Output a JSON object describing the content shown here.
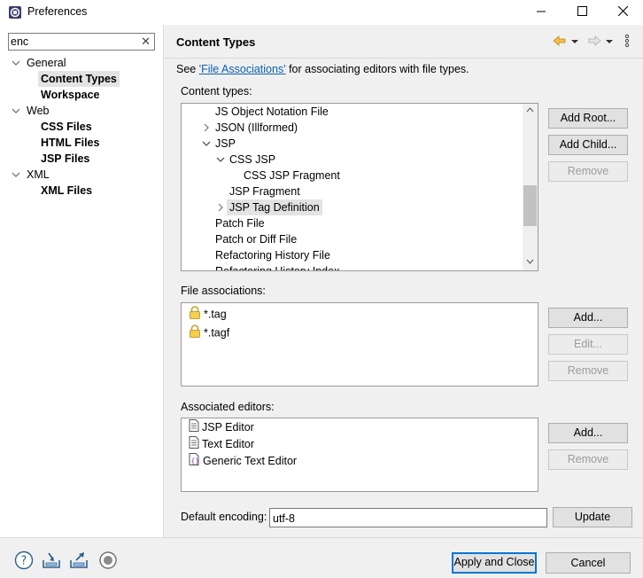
{
  "window": {
    "title": "Preferences",
    "minimize_icon": "minimize-icon",
    "maximize_icon": "maximize-icon",
    "close_icon": "close-icon"
  },
  "filter": {
    "value": "enc"
  },
  "nav_tree": [
    {
      "label": "General"
    },
    {
      "label": "Content Types"
    },
    {
      "label": "Workspace"
    },
    {
      "label": "Web"
    },
    {
      "label": "CSS Files"
    },
    {
      "label": "HTML Files"
    },
    {
      "label": "JSP Files"
    },
    {
      "label": "XML"
    },
    {
      "label": "XML Files"
    }
  ],
  "page": {
    "title": "Content Types",
    "see_prefix": "See ",
    "see_link": "'File Associations'",
    "see_suffix": " for associating editors with file types.",
    "content_types_label": "Content types:",
    "file_associations_label": "File associations:",
    "associated_editors_label": "Associated editors:",
    "default_encoding_label": "Default encoding:",
    "default_encoding_value": "utf-8"
  },
  "content_types": [
    {
      "label": "JS Object Notation File"
    },
    {
      "label": "JSON (Illformed)"
    },
    {
      "label": "JSP"
    },
    {
      "label": "CSS JSP"
    },
    {
      "label": "CSS JSP Fragment"
    },
    {
      "label": "JSP Fragment"
    },
    {
      "label": "JSP Tag Definition"
    },
    {
      "label": "Patch File"
    },
    {
      "label": "Patch or Diff File"
    },
    {
      "label": "Refactoring History File"
    },
    {
      "label": "Refactoring History Index"
    }
  ],
  "file_associations": [
    {
      "label": "*.tag"
    },
    {
      "label": "*.tagf"
    }
  ],
  "associated_editors": [
    {
      "label": "JSP Editor"
    },
    {
      "label": "Text Editor"
    },
    {
      "label": "Generic Text Editor"
    }
  ],
  "buttons": {
    "add_root": "Add Root...",
    "add_child": "Add Child...",
    "remove_ct": "Remove",
    "add_fa": "Add...",
    "edit_fa": "Edit...",
    "remove_fa": "Remove",
    "add_ed": "Add...",
    "remove_ed": "Remove",
    "update": "Update",
    "apply_close": "Apply and Close",
    "cancel": "Cancel"
  }
}
